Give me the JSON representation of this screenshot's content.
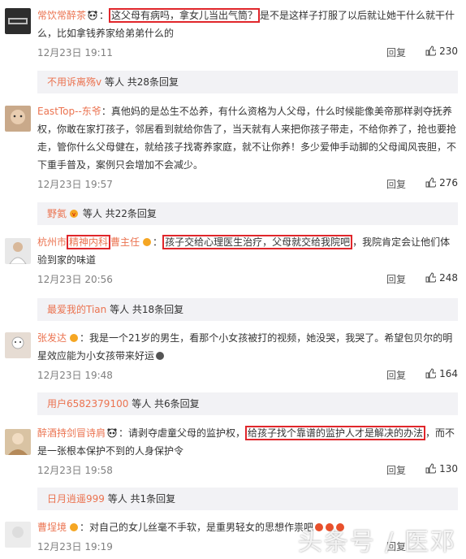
{
  "comments": [
    {
      "user": "常饮常醉茶",
      "text_pre": "：",
      "highlight": "这父母有病吗，拿女儿当出气筒？",
      "text_post": "是不是这样子打服了以后就让她干什么就干什么，比如拿钱养家给弟弟什么的",
      "time": "12月23日 19:11",
      "reply_label": "回复",
      "likes": "230",
      "sub_user": "不用诉离殇v",
      "sub_text": "等人 共28条回复"
    },
    {
      "user": "EastTop--东爷",
      "text_pre": "：真他妈的是怂生不怂养，有什么资格为人父母，什么时候能像美帝那样剥夺抚养权，你敢在家打孩子，邻居看到就给你告了，当天就有人来把你孩子带走，不给你养了，抢也要抢走，管你什么父母健在，就给孩子找寄养家庭，就不让你养！多少爱伸手动脚的父母闻风丧胆，不下重手普及，案例只会增加不会减少。",
      "highlight": "",
      "text_post": "",
      "time": "12月23日 19:57",
      "reply_label": "回复",
      "likes": "276",
      "sub_user": "野氦",
      "sub_text": "等人 共22条回复"
    },
    {
      "user_a": "杭州市",
      "user_hl": "精神内科",
      "user_b": "曹主任",
      "text_pre": "：",
      "highlight": "孩子交给心理医生治疗，父母就交给我院吧",
      "text_post": "，我院肯定会让他们体验到家的味道",
      "time": "12月23日 20:56",
      "reply_label": "回复",
      "likes": "248",
      "sub_user": "最爱我的Tian",
      "sub_text": "等人 共18条回复"
    },
    {
      "user": "张发达",
      "text_pre": "：我是一个21岁的男生，看那个小女孩被打的视频，她没哭，我哭了。希望包贝尔的明星效应能为小女孩带来好运",
      "highlight": "",
      "text_post": "",
      "time": "12月23日 19:48",
      "reply_label": "回复",
      "likes": "164",
      "sub_user": "用户6582379100",
      "sub_text": "等人 共6条回复"
    },
    {
      "user": "醉酒持剑冒诗肩",
      "text_pre": "：请剥夺虐童父母的监护权，",
      "highlight": "给孩子找个靠谱的监护人才是解决的办法",
      "text_post": "，而不是一张根本保护不到的人身保护令",
      "time": "12月23日 19:58",
      "reply_label": "回复",
      "likes": "130",
      "sub_user": "日月逍遥999",
      "sub_text": "等人 共1条回复"
    },
    {
      "user": "曹埕境",
      "text_pre": "：对自己的女儿丝毫不手软，是重男轻女的思想作祟吧",
      "highlight": "",
      "text_post": "",
      "time": "12月23日 19:19",
      "reply_label": "回复",
      "likes": ""
    }
  ],
  "watermark": "头条号 / 医邓",
  "colors": {
    "username": "#eb7350",
    "highlight_border": "#e0262b",
    "sub_bg": "#f2f2f5"
  }
}
